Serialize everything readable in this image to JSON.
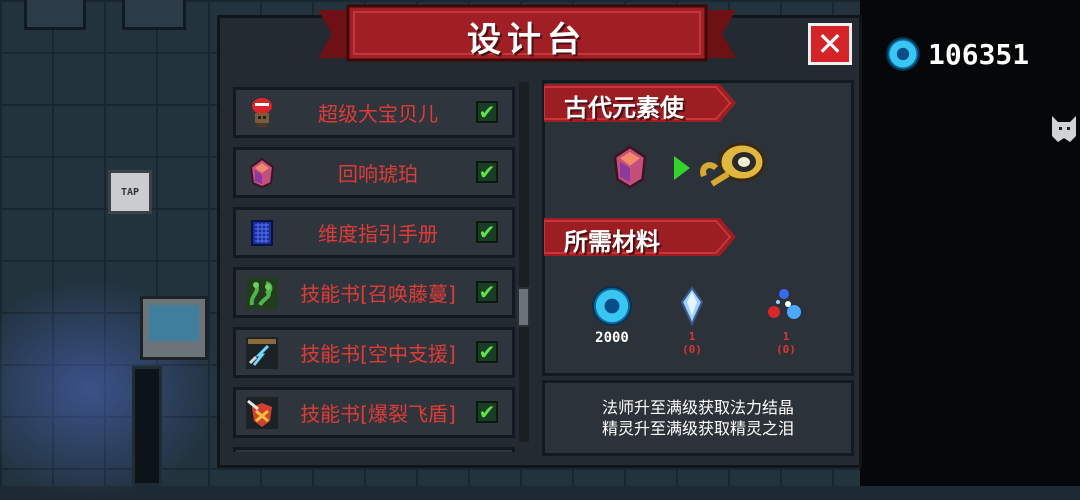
{
  "window": {
    "title": "设计台",
    "close_label": "✕"
  },
  "currency": {
    "icon": "blue-gem-coin-icon",
    "value": "106351"
  },
  "background": {
    "sign_text": "TAP"
  },
  "list": {
    "items": [
      {
        "label": "超级大宝贝儿",
        "icon": "red-helmet-robot-icon",
        "checked": true
      },
      {
        "label": "回响琥珀",
        "icon": "amber-gem-icon",
        "checked": true
      },
      {
        "label": "维度指引手册",
        "icon": "blue-book-icon",
        "checked": true
      },
      {
        "label": "技能书[召唤藤蔓]",
        "icon": "vine-skill-book-icon",
        "checked": true
      },
      {
        "label": "技能书[空中支援]",
        "icon": "air-support-skill-book-icon",
        "checked": true
      },
      {
        "label": "技能书[爆裂飞盾]",
        "icon": "flying-shield-skill-book-icon",
        "checked": true
      }
    ],
    "check_symbol": "✔"
  },
  "detail": {
    "target_title": "古代元素使",
    "materials_title": "所需材料",
    "materials": [
      {
        "name": "blue-gem-coin",
        "count": "2000",
        "owned": ""
      },
      {
        "name": "magic-crystal",
        "count": "1",
        "owned": "(0)"
      },
      {
        "name": "elf-tears",
        "count": "1",
        "owned": "(0)"
      }
    ],
    "description_lines": [
      "法师升至满级获取法力结晶",
      "精灵升至满级获取精灵之泪"
    ]
  },
  "colors": {
    "item_label": "#e03b36",
    "check": "#5fe34a",
    "ribbon": "#9c1e22",
    "close": "#d42428",
    "arrow": "#37d12e"
  }
}
